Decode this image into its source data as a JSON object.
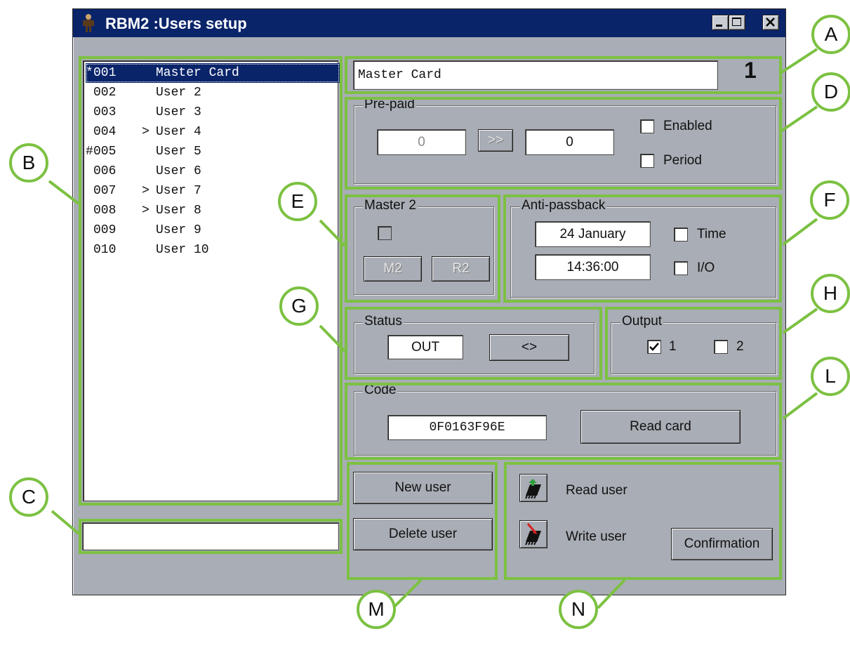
{
  "window": {
    "title": "RBM2 :Users setup",
    "controls": {
      "minimize": "_",
      "maximize": "□",
      "close": "✕"
    }
  },
  "users": [
    {
      "prefix": "*",
      "number": "001",
      "marker": "",
      "name": "Master Card",
      "selected": true
    },
    {
      "prefix": "",
      "number": "002",
      "marker": "",
      "name": "User 2",
      "selected": false
    },
    {
      "prefix": "",
      "number": "003",
      "marker": "",
      "name": "User 3",
      "selected": false
    },
    {
      "prefix": "",
      "number": "004",
      "marker": ">",
      "name": "User 4",
      "selected": false
    },
    {
      "prefix": "#",
      "number": "005",
      "marker": "",
      "name": "User 5",
      "selected": false
    },
    {
      "prefix": "",
      "number": "006",
      "marker": "",
      "name": "User 6",
      "selected": false
    },
    {
      "prefix": "",
      "number": "007",
      "marker": ">",
      "name": "User 7",
      "selected": false
    },
    {
      "prefix": "",
      "number": "008",
      "marker": ">",
      "name": "User 8",
      "selected": false
    },
    {
      "prefix": "",
      "number": "009",
      "marker": "",
      "name": "User 9",
      "selected": false
    },
    {
      "prefix": "",
      "number": "010",
      "marker": "",
      "name": "User 10",
      "selected": false
    }
  ],
  "search_field": {
    "value": ""
  },
  "user_name": {
    "value": "Master Card",
    "index": "1"
  },
  "prepaid": {
    "legend": "Pre-paid",
    "left_value": "0",
    "transfer_label": ">>",
    "right_value": "0",
    "enabled_label": "Enabled",
    "enabled_checked": false,
    "period_label": "Period",
    "period_checked": false
  },
  "master2": {
    "legend": "Master 2",
    "checked": false,
    "m2_label": "M2",
    "r2_label": "R2"
  },
  "antipassback": {
    "legend": "Anti-passback",
    "date": "24 January",
    "time": "14:36:00",
    "time_label": "Time",
    "time_checked": false,
    "io_label": "I/O",
    "io_checked": false
  },
  "status": {
    "legend": "Status",
    "value": "OUT",
    "toggle_label": "<>"
  },
  "output": {
    "legend": "Output",
    "out1_label": "1",
    "out1_checked": true,
    "out2_label": "2",
    "out2_checked": false
  },
  "code": {
    "legend": "Code",
    "value": "0F0163F96E",
    "read_card_label": "Read card"
  },
  "user_actions": {
    "new_user_label": "New user",
    "delete_user_label": "Delete user"
  },
  "device_actions": {
    "read_user_label": "Read user",
    "write_user_label": "Write user",
    "confirmation_label": "Confirmation"
  },
  "annotations": [
    "A",
    "B",
    "C",
    "D",
    "E",
    "F",
    "G",
    "H",
    "L",
    "M",
    "N"
  ],
  "colors": {
    "annotation_green": "#7cc142",
    "window_gray": "#a9adb5",
    "title_blue": "#0a246a",
    "selection_blue": "#0a246a"
  },
  "icons": {
    "app": "user-figure-icon",
    "read": "chip-read-icon",
    "write": "chip-write-icon",
    "check": "checkmark-icon"
  }
}
